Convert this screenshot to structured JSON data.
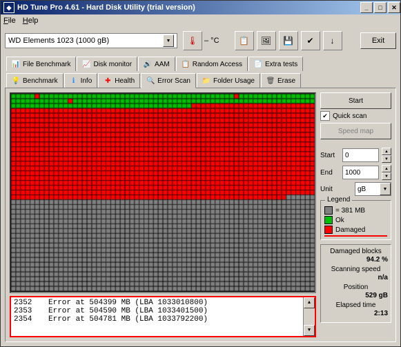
{
  "title": "HD Tune Pro 4.61 - Hard Disk Utility (trial version)",
  "menu": {
    "file": "File",
    "help": "Help"
  },
  "drive_selected": "WD     Elements 1023   (1000 gB)",
  "temp": "– °C",
  "exit": "Exit",
  "tabs_top": [
    {
      "icon": "📊",
      "label": "File Benchmark",
      "color": "#6a5acd"
    },
    {
      "icon": "📈",
      "label": "Disk monitor",
      "color": "#008000"
    },
    {
      "icon": "🔊",
      "label": "AAM",
      "color": "#ffa500"
    },
    {
      "icon": "📋",
      "label": "Random Access",
      "color": "#808000"
    },
    {
      "icon": "📄",
      "label": "Extra tests",
      "color": "#008080"
    }
  ],
  "tabs_bottom": [
    {
      "icon": "💡",
      "label": "Benchmark",
      "color": "#ffa500"
    },
    {
      "icon": "ℹ",
      "label": "Info",
      "color": "#1e90ff"
    },
    {
      "icon": "✚",
      "label": "Health",
      "color": "#ff0000"
    },
    {
      "icon": "🔍",
      "label": "Error Scan",
      "color": "#008000",
      "active": true
    },
    {
      "icon": "📁",
      "label": "Folder Usage",
      "color": "#ffa500"
    },
    {
      "icon": "🗑",
      "label": "Erase",
      "color": "#404040"
    }
  ],
  "controls": {
    "start": "Start",
    "quick_scan": "Quick scan",
    "speed_map": "Speed map",
    "start_label": "Start",
    "start_value": "0",
    "end_label": "End",
    "end_value": "1000",
    "unit_label": "Unit",
    "unit_value": "gB"
  },
  "legend": {
    "title": "Legend",
    "block_size": "= 381 MB",
    "ok": "Ok",
    "damaged": "Damaged"
  },
  "stats": {
    "damaged_label": "Damaged blocks",
    "damaged_value": "94.2 %",
    "speed_label": "Scanning speed",
    "speed_value": "n/a",
    "position_label": "Position",
    "position_value": "529 gB",
    "elapsed_label": "Elapsed time",
    "elapsed_value": "2:13"
  },
  "colors": {
    "green": "#00c000",
    "red": "#ff0000",
    "gray": "#808080"
  },
  "errors": [
    {
      "n": "2352",
      "msg": "Error at 504399 MB (LBA 1033010800)"
    },
    {
      "n": "2353",
      "msg": "Error at 504590 MB (LBA 1033401500)"
    },
    {
      "n": "2354",
      "msg": "Error at 504781 MB (LBA 1033792200)"
    }
  ],
  "chart_data": {
    "type": "heatmap",
    "title": "Disk surface scan map",
    "cols": 64,
    "rows": 41,
    "states": {
      "ok": "green (Ok)",
      "damaged": "red (Damaged)",
      "unscanned": "gray (not scanned)"
    },
    "layout_description": "Rows 0-1 mostly green (Ok) with a few red blocks; row 2 green for first ~60% then red; rows 3-20 solid red (Damaged); row 21 red then gray for last ~6 blocks; rows 22-40 solid gray (unscanned).",
    "ok_rows": [
      0,
      1
    ],
    "damaged_full_rows_start": 3,
    "damaged_full_rows_end": 20,
    "partial_row_2_green_cols": 38,
    "partial_row_21_red_cols": 58,
    "unscanned_rows_start": 22
  }
}
